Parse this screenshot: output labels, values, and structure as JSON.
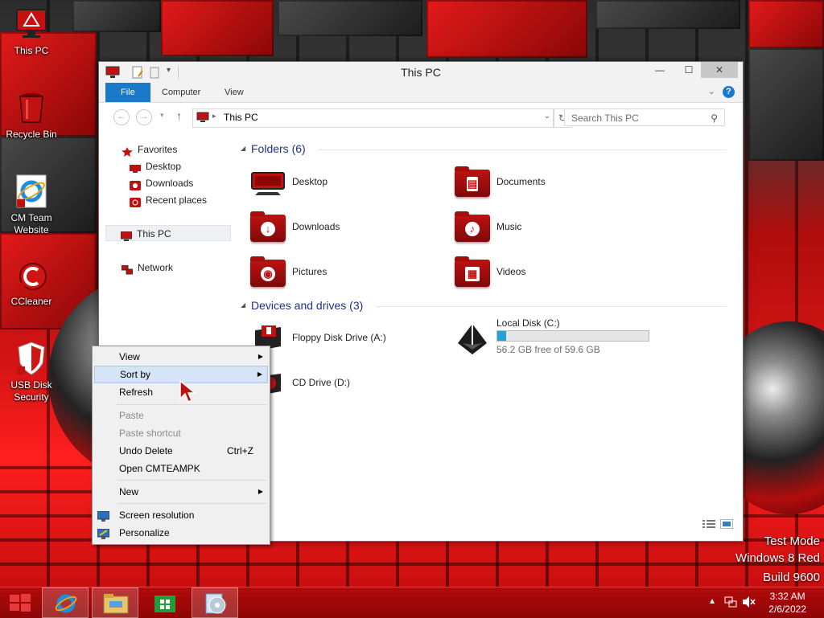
{
  "desktop": {
    "icons": [
      {
        "label": "This PC"
      },
      {
        "label": "Recycle Bin"
      },
      {
        "label": "CM Team Website"
      },
      {
        "label": "CCleaner"
      },
      {
        "label": "USB Disk Security"
      }
    ],
    "watermark": {
      "line1": "Test Mode",
      "line2": "Windows 8 Red",
      "line3": "Build 9600"
    }
  },
  "window": {
    "title": "This PC",
    "ribbon_tabs": [
      "File",
      "Computer",
      "View"
    ],
    "address": "This PC",
    "search_placeholder": "Search This PC",
    "nav": {
      "favorites": "Favorites",
      "fav_items": [
        "Desktop",
        "Downloads",
        "Recent places"
      ],
      "this_pc": "This PC",
      "network": "Network"
    },
    "folders_header": "Folders (6)",
    "folders": [
      "Desktop",
      "Documents",
      "Downloads",
      "Music",
      "Pictures",
      "Videos"
    ],
    "devices_header": "Devices and drives (3)",
    "devices": {
      "floppy": "Floppy Disk Drive (A:)",
      "local_disk": "Local Disk (C:)",
      "local_disk_free": "56.2 GB free of 59.6 GB",
      "local_disk_used_fraction": 0.057,
      "cd": "CD Drive (D:)"
    }
  },
  "context_menu": {
    "view": "View",
    "sort_by": "Sort by",
    "refresh": "Refresh",
    "paste": "Paste",
    "paste_shortcut": "Paste shortcut",
    "undo_delete": "Undo Delete",
    "undo_shortcut": "Ctrl+Z",
    "open_cmteampk": "Open CMTEAMPK",
    "new": "New",
    "screen_resolution": "Screen resolution",
    "personalize": "Personalize"
  },
  "taskbar": {
    "time": "3:32 AM",
    "date": "2/6/2022"
  },
  "colors": {
    "accent": "#1979ca",
    "theme_red": "#c01212",
    "menu_highlight": "#d5e5f7"
  }
}
